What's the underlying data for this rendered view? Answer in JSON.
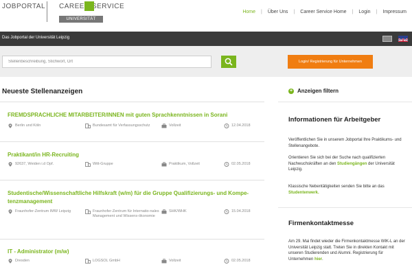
{
  "header": {
    "logo_jobportal": "JOBPORTAL",
    "logo_career": "CAREER SERVICE",
    "logo_uni": "UNIVERSITÄT LEIPZIG",
    "nav": [
      {
        "label": "Home",
        "active": true
      },
      {
        "label": "Über Uns",
        "active": false
      },
      {
        "label": "Career Service Home",
        "active": false
      },
      {
        "label": "Login",
        "active": false
      },
      {
        "label": "Impressum",
        "active": false
      }
    ]
  },
  "bar": {
    "tagline": "Das Jobportal der Universität Leipzig"
  },
  "search": {
    "placeholder": "Stellenbeschreibung, Stichwort, Ort",
    "login_label": "Login/ Registrierung für Unternehmen"
  },
  "main": {
    "title": "Neueste Stellenanzeigen",
    "jobs": [
      {
        "title": "FREMDSPRACHLICHE MITARBEITER/INNEN mit guten Sprachkenntnissen in Sorani",
        "location": "Berlin und Köln",
        "company": "Bundesamt für Verfassungsschutz",
        "type": "Vollzeit",
        "date": "12.04.2018"
      },
      {
        "title": "Praktikant/in HR-Recruiting",
        "location": "92637, Weiden i.d Opf.",
        "company": "Witt-Gruppe",
        "type": "Praktikum, Vollzeit",
        "date": "02.05.2018"
      },
      {
        "title": "Studentische/Wissenschaftliche Hilfskraft (w/m) für die Gruppe Qualifizierungs- und Kompe-tenzmanagement",
        "location": "Fraunhofer-Zentrum IMW Leipzig",
        "company": "Fraunhofer-Zentrum für Internatio-nales Management und Wissens-ökonomie",
        "type": "SHK/WHK",
        "date": "15.04.2018"
      },
      {
        "title": "IT - Administrator (m/w)",
        "location": "Dresden",
        "company": "LOGSOL GmbH",
        "type": "Vollzeit",
        "date": "02.05.2018"
      }
    ]
  },
  "sidebar": {
    "filter_label": "Anzeigen filtern",
    "info_title": "Informationen für Arbeitgeber",
    "info_p1": "Veröffentlichen Sie in unserem Jobportal Ihre Praktikums- und Stellenangebote.",
    "info_p2_a": "Orientieren Sie sich bei der Suche nach qualifizierten Nachwuchskräften an den ",
    "info_p2_link": "Studiengängen",
    "info_p2_b": " der Universität Leipzig.",
    "info_p3_a": "Klassische Nebentätigkeiten senden Sie bitte an das ",
    "info_p3_link": "Studentenwerk.",
    "fair_title": "Firmenkontaktmesse",
    "fair_p_a": "Am 29. Mai findet wieder die Firmenkontaktmesse WIK-L an der Universität Leipzig statt. Treten Sie in direkten Kontakt mit unseren Studierenden und Alumni. Registrierung für Unternehmen ",
    "fair_p_link": "hier",
    "fair_p_b": "."
  },
  "colors": {
    "accent": "#7ab51d",
    "orange": "#f07d11",
    "dark": "#3a3a3a"
  }
}
